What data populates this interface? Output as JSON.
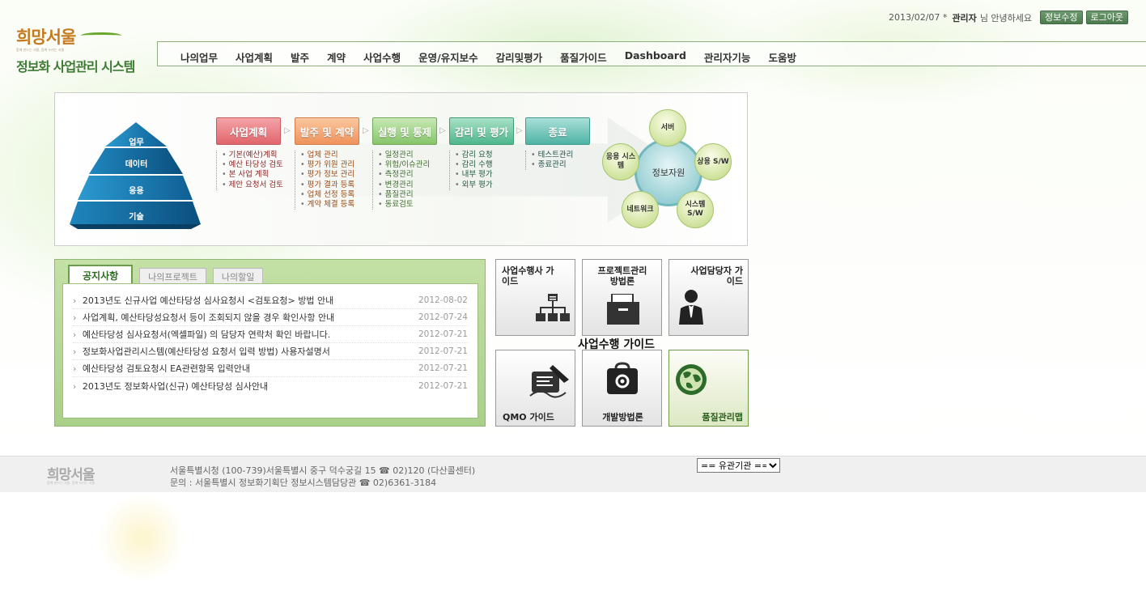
{
  "header": {
    "logo_slogan": "희망서울",
    "logo_sub": "함께 만드는 서울, 함께 누리는 서울",
    "system_title": "정보화 사업관리 시스템",
    "date": "2013/02/07 *",
    "user": "관리자",
    "greeting": "님 안녕하세요",
    "profile_btn": "정보수정",
    "logout_btn": "로그아웃"
  },
  "nav": [
    "나의업무",
    "사업계획",
    "발주",
    "계약",
    "사업수행",
    "운영/유지보수",
    "감리및평가",
    "품질가이드",
    "Dashboard",
    "관리자기능",
    "도움방"
  ],
  "banner": {
    "pyramid": [
      "업무",
      "데이터",
      "응용",
      "기술"
    ],
    "stages": [
      {
        "title": "사업계획",
        "items": [
          "기본(예산)계획",
          "예산 타당성 검토",
          "본 사업 계획",
          "제안 요청서 검토"
        ]
      },
      {
        "title": "발주 및 계약",
        "items": [
          "업체 관리",
          "평가 위원 관리",
          "평가 정보 관리",
          "평가 결과 등록",
          "업체 선정 등록",
          "계약 체결 등록"
        ]
      },
      {
        "title": "실행 및 통제",
        "items": [
          "일정관리",
          "위험/이슈관리",
          "측정관리",
          "변경관리",
          "품질관리",
          "동료검토"
        ]
      },
      {
        "title": "감리 및 평가",
        "items": [
          "감리 요청",
          "감리 수행",
          "내부 평가",
          "외부 평가"
        ]
      },
      {
        "title": "종료",
        "items": [
          "테스트관리",
          "종료관리"
        ]
      }
    ],
    "ring": {
      "center": "정보자원",
      "nodes": [
        "서버",
        "상용 S/W",
        "시스템 S/W",
        "네트워크",
        "응용 시스템"
      ]
    }
  },
  "notice": {
    "tabs": [
      "공지사항",
      "나의프로젝트",
      "나의할일"
    ],
    "items": [
      {
        "title": "2013년도 신규사업 예산타당성 심사요청시 <검토요청> 방법 안내",
        "date": "2012-08-02"
      },
      {
        "title": "사업계획, 예산타당성요청서 등이 조회되지 않을 경우 확인사항 안내",
        "date": "2012-07-24"
      },
      {
        "title": "예산타당성 심사요청서(엑셀파일) 의 담당자 연락처 확인 바랍니다.",
        "date": "2012-07-21"
      },
      {
        "title": "정보화사업관리시스템(예산타당성 요청서 입력 방법) 사용자설명서",
        "date": "2012-07-21"
      },
      {
        "title": "예산타당성 검토요청시 EA관련항목 입력안내",
        "date": "2012-07-21"
      },
      {
        "title": "2013년도 정보화사업(신규) 예산타당성 심사안내",
        "date": "2012-07-21"
      }
    ]
  },
  "guides": {
    "title": "사업수행 가이드",
    "tiles": [
      "사업수행사 가이드",
      "프로젝트관리 방법론",
      "사업담당자 가이드",
      "QMO 가이드",
      "개발방법론",
      "품질관리맵"
    ]
  },
  "footer": {
    "logo": "희망서울",
    "address": "서울특별시청 (100-739)서울특별시 중구 덕수궁길 15 ☎ 02)120 (다산콜센터)",
    "contact": "문의 : 서울특별시 정보화기획단 정보시스템담당관 ☎ 02)6361-3184",
    "select_value": "== 유관기관 =="
  }
}
